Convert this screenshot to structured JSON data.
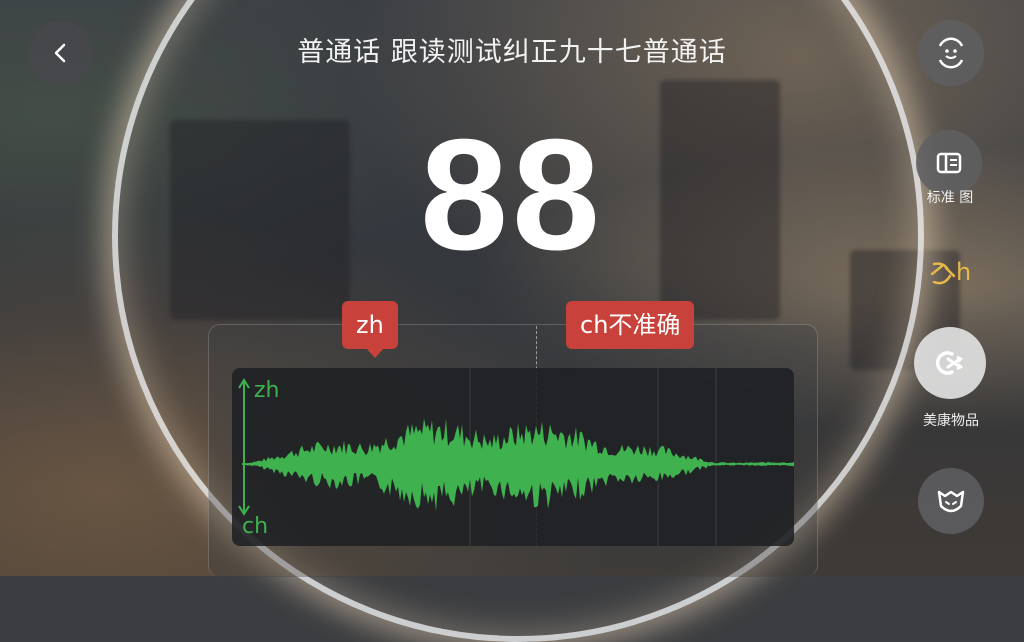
{
  "header": {
    "title": "普通话 跟读测试纠正九十七普通话"
  },
  "score": "88",
  "tags": {
    "zh": "zh",
    "ch": "ch不准确"
  },
  "waveform": {
    "top_label": "zh",
    "bottom_label": "ch",
    "color": "#3fb24f"
  },
  "sidebar": {
    "items": [
      {
        "icon": "face-refresh-icon",
        "label": ""
      },
      {
        "icon": "book-icon",
        "label": "标准 图"
      },
      {
        "icon": "zh-symbol-icon",
        "label": "h"
      },
      {
        "icon": "shuffle-icon",
        "label": "美康物品"
      },
      {
        "icon": "mask-icon",
        "label": ""
      }
    ]
  },
  "colors": {
    "accent_red": "#c8423b",
    "wave_green": "#3fb24f",
    "zh_gold": "#e5b84a"
  }
}
